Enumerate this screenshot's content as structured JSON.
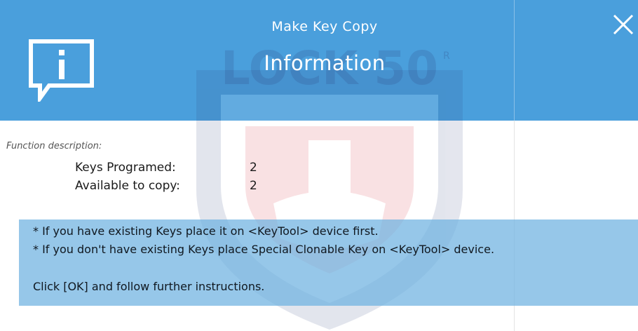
{
  "header": {
    "subtitle": "Make Key Copy",
    "title": "Information",
    "icon": "info-icon",
    "close_icon": "close-icon"
  },
  "watermark": {
    "text": "LOCK 50",
    "registered_mark": "R"
  },
  "content": {
    "section_label": "Function description:",
    "rows": [
      {
        "label": "Keys Programed:",
        "value": "2"
      },
      {
        "label": "Available to copy:",
        "value": "2"
      }
    ],
    "notice_lines": [
      "* If you have existing Keys place it on <KeyTool> device first.",
      "* If you don't have existing Keys place Special Clonable Key on <KeyTool> device.",
      "Click [OK] and follow further instructions."
    ]
  },
  "colors": {
    "header_bg": "#4a9fdc",
    "notice_bg": "#6eb2e1",
    "watermark_red": "#d9232d",
    "watermark_navy": "#2c3e7a"
  }
}
